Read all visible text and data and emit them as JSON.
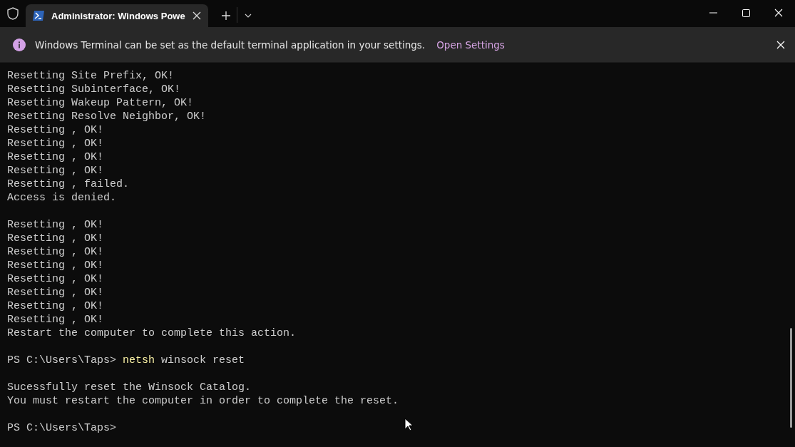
{
  "tab": {
    "title": "Administrator: Windows Powe",
    "selected": true
  },
  "infobar": {
    "message": "Windows Terminal can be set as the default terminal application in your settings.",
    "link": "Open Settings"
  },
  "terminal": {
    "lines": [
      {
        "kind": "output",
        "text": "Resetting Site Prefix, OK!"
      },
      {
        "kind": "output",
        "text": "Resetting Subinterface, OK!"
      },
      {
        "kind": "output",
        "text": "Resetting Wakeup Pattern, OK!"
      },
      {
        "kind": "output",
        "text": "Resetting Resolve Neighbor, OK!"
      },
      {
        "kind": "output",
        "text": "Resetting , OK!"
      },
      {
        "kind": "output",
        "text": "Resetting , OK!"
      },
      {
        "kind": "output",
        "text": "Resetting , OK!"
      },
      {
        "kind": "output",
        "text": "Resetting , OK!"
      },
      {
        "kind": "output",
        "text": "Resetting , failed."
      },
      {
        "kind": "output",
        "text": "Access is denied."
      },
      {
        "kind": "blank"
      },
      {
        "kind": "output",
        "text": "Resetting , OK!"
      },
      {
        "kind": "output",
        "text": "Resetting , OK!"
      },
      {
        "kind": "output",
        "text": "Resetting , OK!"
      },
      {
        "kind": "output",
        "text": "Resetting , OK!"
      },
      {
        "kind": "output",
        "text": "Resetting , OK!"
      },
      {
        "kind": "output",
        "text": "Resetting , OK!"
      },
      {
        "kind": "output",
        "text": "Resetting , OK!"
      },
      {
        "kind": "output",
        "text": "Resetting , OK!"
      },
      {
        "kind": "output",
        "text": "Restart the computer to complete this action."
      },
      {
        "kind": "blank"
      },
      {
        "kind": "prompt",
        "prompt": "PS C:\\Users\\Taps>",
        "command": "netsh",
        "args": "winsock reset"
      },
      {
        "kind": "blank"
      },
      {
        "kind": "output",
        "text": "Sucessfully reset the Winsock Catalog."
      },
      {
        "kind": "output",
        "text": "You must restart the computer in order to complete the reset."
      },
      {
        "kind": "blank"
      },
      {
        "kind": "prompt",
        "prompt": "PS C:\\Users\\Taps>"
      }
    ]
  }
}
